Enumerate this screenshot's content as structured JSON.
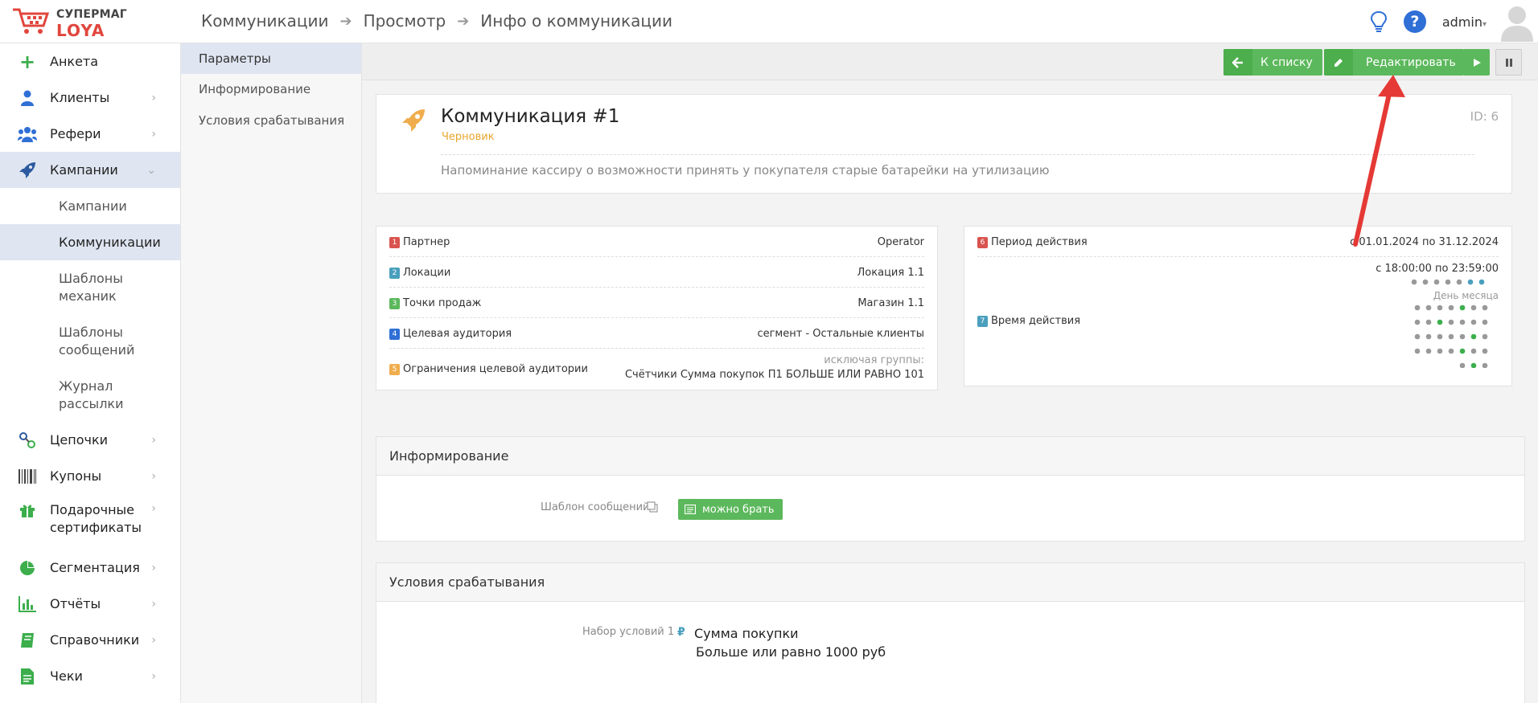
{
  "brand": {
    "line1": "СУПЕРМАГ",
    "line2": "LOYA"
  },
  "breadcrumb": [
    "Коммуникации",
    "Просмотр",
    "Инфо о коммуникации"
  ],
  "user": {
    "name": "admin"
  },
  "sidebar": {
    "items": [
      {
        "label": "Анкета",
        "icon": "plus-icon"
      },
      {
        "label": "Клиенты",
        "icon": "user-icon"
      },
      {
        "label": "Рефери",
        "icon": "users-icon"
      },
      {
        "label": "Кампании",
        "icon": "rocket-icon"
      },
      {
        "label": "Цепочки",
        "icon": "chain-icon"
      },
      {
        "label": "Купоны",
        "icon": "barcode-icon"
      },
      {
        "label": "Подарочные сертификаты",
        "icon": "gift-icon"
      },
      {
        "label": "Сегментация",
        "icon": "pie-icon"
      },
      {
        "label": "Отчёты",
        "icon": "bar-chart-icon"
      },
      {
        "label": "Справочники",
        "icon": "book-icon"
      },
      {
        "label": "Чеки",
        "icon": "receipt-icon"
      }
    ],
    "sub_items": [
      "Кампании",
      "Коммуникации",
      "Шаблоны механик",
      "Шаблоны сообщений",
      "Журнал рассылки"
    ]
  },
  "subnav": [
    "Параметры",
    "Информирование",
    "Условия срабатывания"
  ],
  "actions": {
    "back": "К списку",
    "edit": "Редактировать"
  },
  "communication": {
    "title": "Коммуникация #1",
    "status": "Черновик",
    "id_label": "ID: 6",
    "description": "Напоминание кассиру о возможности принять у покупателя старые батарейки на утилизацию"
  },
  "params": [
    {
      "num": "1",
      "label": "Партнер",
      "value": "Operator",
      "color": "#d9534f"
    },
    {
      "num": "2",
      "label": "Локации",
      "value": "Локация 1.1",
      "color": "#4a9fbd"
    },
    {
      "num": "3",
      "label": "Точки продаж",
      "value": "Магазин 1.1",
      "color": "#5cb85c"
    },
    {
      "num": "4",
      "label": "Целевая аудитория",
      "value": "сегмент - Остальные клиенты",
      "color": "#2f6fd6"
    },
    {
      "num": "5",
      "label": "Ограничения целевой аудитории",
      "value_note": "исключая группы:",
      "value": "Счётчики Сумма покупок П1 БОЛЬШЕ ИЛИ РАВНО 101",
      "color": "#f0ad4e"
    }
  ],
  "period": {
    "num6": "6",
    "label": "Период действия",
    "value": "с 01.01.2024 по 31.12.2024",
    "num7": "7",
    "time_label": "Время действия",
    "time_value": "с 18:00:00 по 23:59:00",
    "day_of_month_label": "День месяца"
  },
  "informing": {
    "header": "Информирование",
    "template_label": "Шаблон сообщений",
    "template_value": "можно брать"
  },
  "conditions": {
    "header": "Условия срабатывания",
    "set_label": "Набор условий 1",
    "currency_icon": "₽",
    "title": "Сумма покупки",
    "detail": "Больше или равно 1000 руб"
  },
  "colors": {
    "accent_green": "#5cb85c",
    "brand_red": "#e0463d",
    "status_orange": "#e8a52c",
    "arrow_red": "#e53935"
  }
}
